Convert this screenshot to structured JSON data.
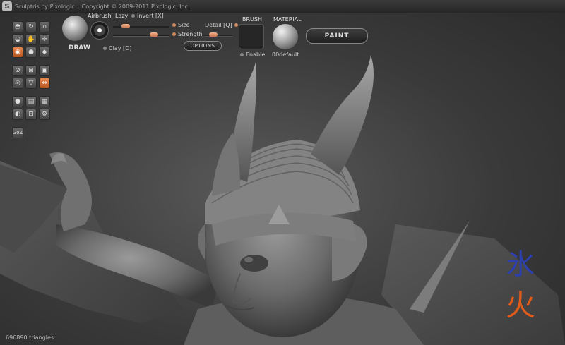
{
  "window": {
    "app_title": "Sculptris by Pixologic",
    "copyright": "Copyright © 2009-2011 Pixologic, Inc.",
    "logo_letter": "S"
  },
  "toolbar": {
    "draw_label": "DRAW",
    "airbrush_label": "Airbrush",
    "lazy_label": "Lazy",
    "invert_label": "Invert [X]",
    "size_label": "Size",
    "strength_label": "Strength",
    "detail_label": "Detail [Q]",
    "clay_label": "Clay [D]",
    "options_label": "OPTIONS",
    "brush_label": "BRUSH",
    "enable_label": "Enable",
    "material_label": "MATERIAL",
    "material_name": "00default",
    "paint_label": "PAINT",
    "goz_label": "GoZ"
  },
  "status": {
    "triangles": "696890 triangles"
  },
  "colors": {
    "accent": "#d07a45",
    "panel_bg": "#2b2b2b",
    "kanji_ice": "#2c3fb0",
    "kanji_fire": "#e05a1a"
  },
  "overlay": {
    "kanji_top": "氷",
    "kanji_bottom": "火"
  }
}
